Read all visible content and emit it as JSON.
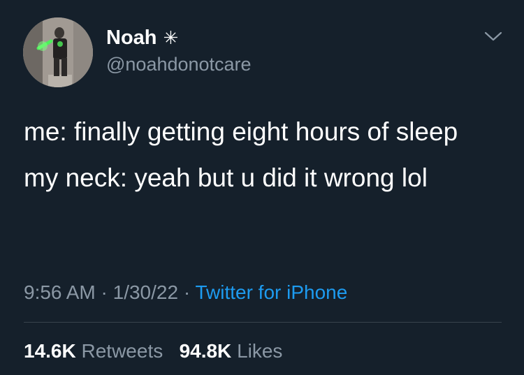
{
  "author": {
    "display_name": "Noah",
    "name_glyph": "✳",
    "handle": "@noahdonotcare",
    "avatar_icon": "avatar-photo"
  },
  "menu": {
    "icon": "chevron-down-icon"
  },
  "tweet": {
    "lines": [
      "me: finally getting eight hours of sleep",
      "my neck: yeah but u did it wrong lol"
    ]
  },
  "meta": {
    "time": "9:56 AM",
    "separator": "·",
    "date": "1/30/22",
    "source": "Twitter for iPhone"
  },
  "stats": {
    "retweets_count": "14.6K",
    "retweets_label": "Retweets",
    "likes_count": "94.8K",
    "likes_label": "Likes"
  },
  "colors": {
    "background": "#15202b",
    "text": "#ffffff",
    "secondary_text": "#8b98a5",
    "link": "#1d9bf0",
    "divider": "#38444d"
  }
}
